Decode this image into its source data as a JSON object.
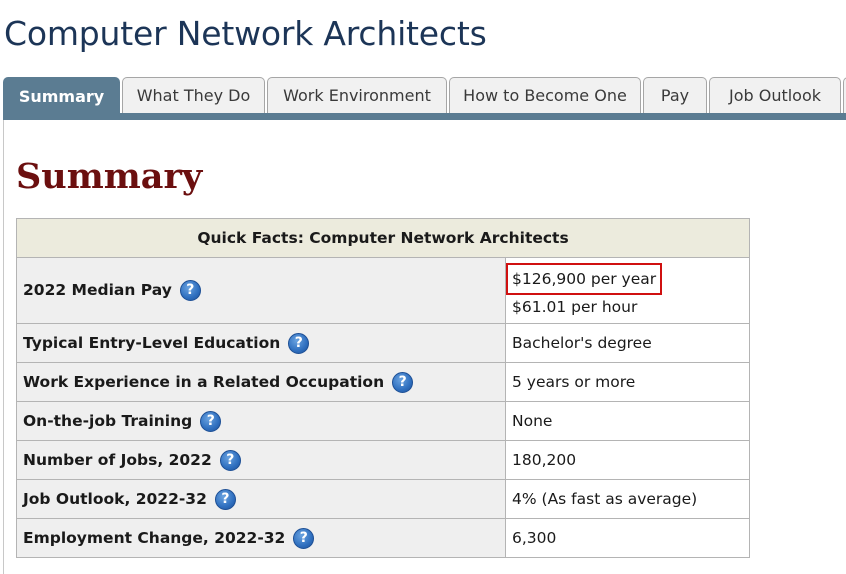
{
  "page": {
    "title": "Computer Network Architects"
  },
  "tabs": [
    {
      "label": "Summary",
      "active": true
    },
    {
      "label": "What They Do",
      "active": false
    },
    {
      "label": "Work Environment",
      "active": false
    },
    {
      "label": "How to Become One",
      "active": false
    },
    {
      "label": "Pay",
      "active": false
    },
    {
      "label": "Job Outlook",
      "active": false
    }
  ],
  "section": {
    "heading": "Summary"
  },
  "quick_facts": {
    "caption": "Quick Facts: Computer Network Architects",
    "help_symbol": "?",
    "rows": [
      {
        "label": "2022 Median Pay",
        "value": "$126,900 per year",
        "value2": "$61.01 per hour"
      },
      {
        "label": "Typical Entry-Level Education",
        "value": "Bachelor's degree"
      },
      {
        "label": "Work Experience in a Related Occupation",
        "value": "5 years or more"
      },
      {
        "label": "On-the-job Training",
        "value": "None"
      },
      {
        "label": "Number of Jobs, 2022",
        "value": "180,200"
      },
      {
        "label": "Job Outlook, 2022-32",
        "value": "4% (As fast as average)"
      },
      {
        "label": "Employment Change, 2022-32",
        "value": "6,300"
      }
    ]
  },
  "colors": {
    "title": "#1c3557",
    "tab_active": "#5b7c92",
    "summary_heading": "#6b0f0f",
    "highlight_box": "#d01010",
    "help_icon": "#2f6fbf"
  }
}
